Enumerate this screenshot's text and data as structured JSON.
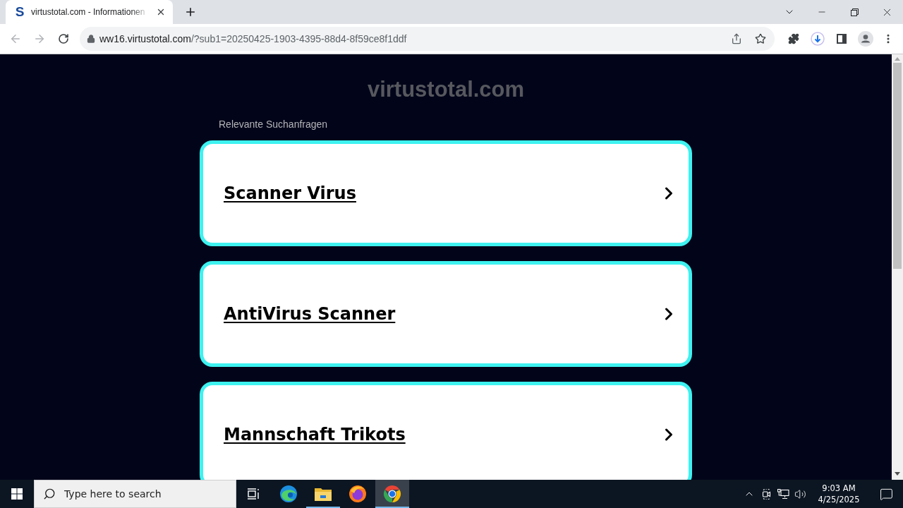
{
  "browser": {
    "tab": {
      "favicon": "S",
      "title": "virtustotal.com - Informationen",
      "selected": true
    },
    "address": {
      "host": "ww16.virtustotal.com",
      "path": "/?sub1=20250425-1903-4395-88d4-8f59ce8f1ddf"
    }
  },
  "page": {
    "site_title": "virtustotal.com",
    "section_label": "Relevante Suchanfragen",
    "links": [
      {
        "label": "Scanner Virus"
      },
      {
        "label": "AntiVirus Scanner"
      },
      {
        "label": "Mannschaft Trikots"
      }
    ]
  },
  "taskbar": {
    "search": {
      "placeholder": "Type here to search"
    },
    "apps": [
      {
        "kind": "edge",
        "selected": false,
        "running": false
      },
      {
        "kind": "explorer",
        "selected": false,
        "running": true
      },
      {
        "kind": "firefox",
        "selected": false,
        "running": false
      },
      {
        "kind": "chrome",
        "selected": true,
        "running": true
      }
    ],
    "clock": {
      "time": "9:03 AM",
      "date": "4/25/2025"
    }
  }
}
